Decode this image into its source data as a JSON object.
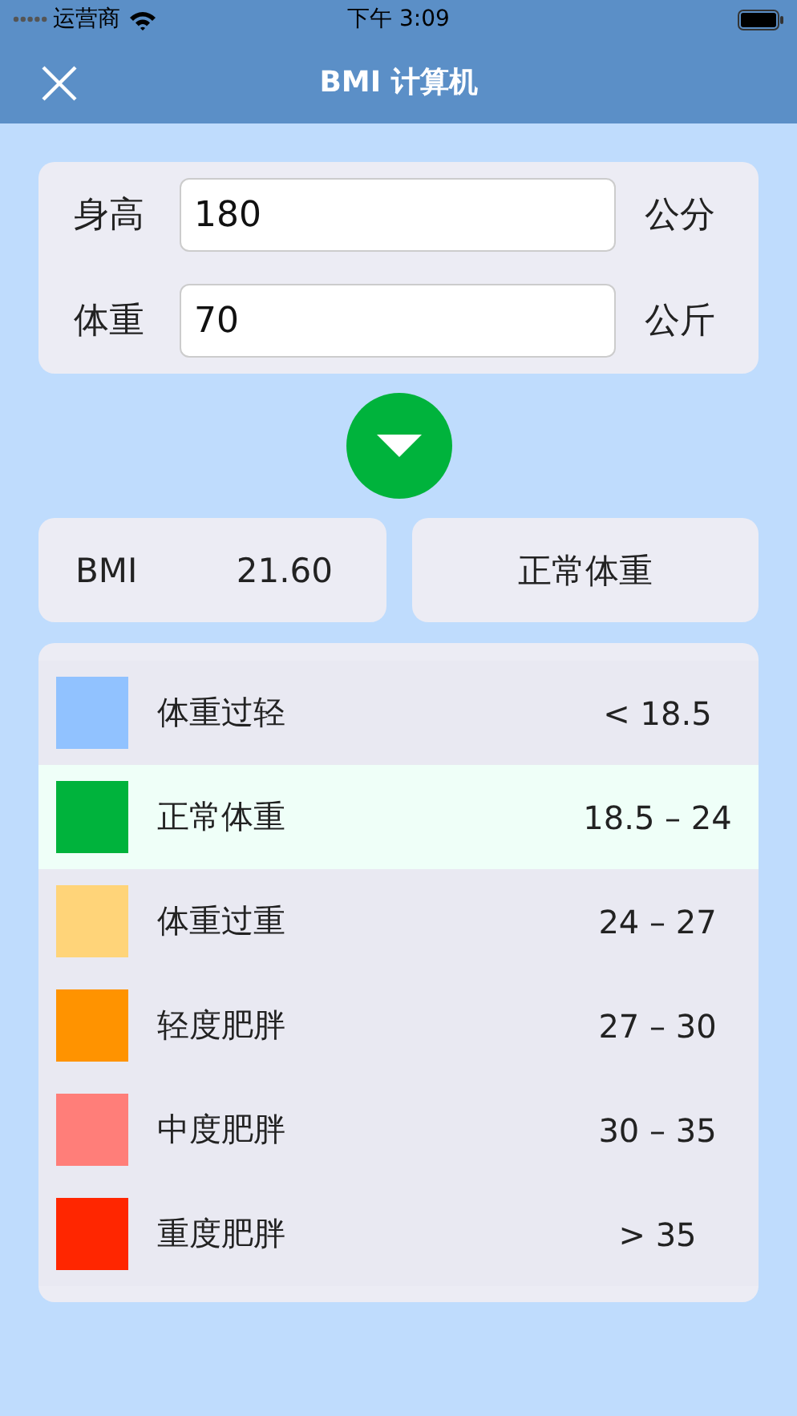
{
  "status_bar": {
    "carrier": "运营商",
    "time": "下午 3:09"
  },
  "nav": {
    "title": "BMI 计算机"
  },
  "inputs": [
    {
      "label": "身高",
      "value": "180",
      "unit": "公分"
    },
    {
      "label": "体重",
      "value": "70",
      "unit": "公斤"
    }
  ],
  "result": {
    "label": "BMI",
    "value": "21.60",
    "category": "正常体重"
  },
  "categories": [
    {
      "name": "体重过轻",
      "range": "< 18.5",
      "color": "#91c2ff",
      "selected": false
    },
    {
      "name": "正常体重",
      "range": "18.5 – 24",
      "color": "#00b33c",
      "selected": true
    },
    {
      "name": "体重过重",
      "range": "24 – 27",
      "color": "#ffd479",
      "selected": false
    },
    {
      "name": "轻度肥胖",
      "range": "27 – 30",
      "color": "#ff9300",
      "selected": false
    },
    {
      "name": "中度肥胖",
      "range": "30 – 35",
      "color": "#ff7e79",
      "selected": false
    },
    {
      "name": "重度肥胖",
      "range": "> 35",
      "color": "#ff2600",
      "selected": false
    }
  ]
}
